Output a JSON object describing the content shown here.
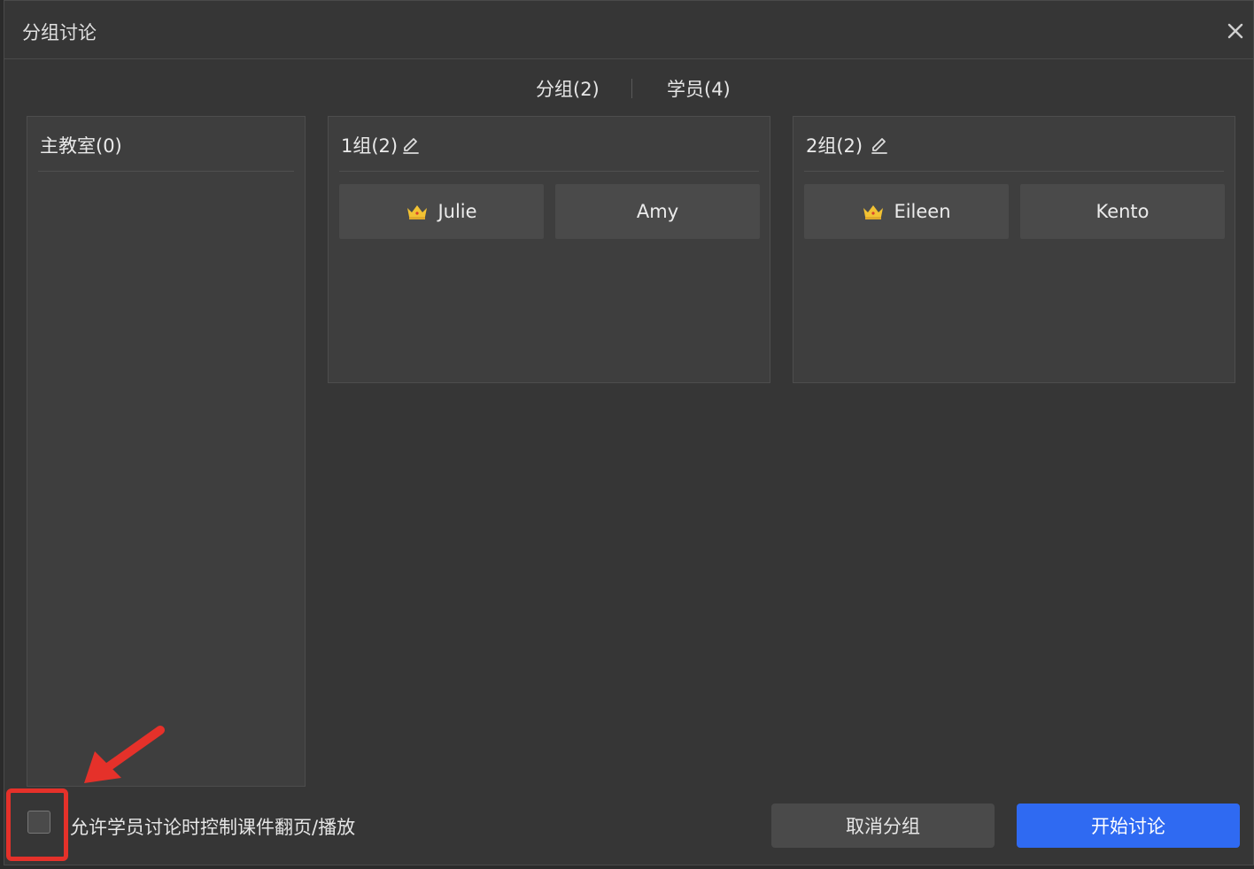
{
  "dialog": {
    "title": "分组讨论"
  },
  "tabs": {
    "groups_label": "分组(2)",
    "students_label": "学员(4)"
  },
  "main_room": {
    "title": "主教室(0)"
  },
  "groups": [
    {
      "title": "1组(2)",
      "members": [
        {
          "name": "Julie",
          "is_leader": true
        },
        {
          "name": "Amy",
          "is_leader": false
        }
      ]
    },
    {
      "title": "2组(2)",
      "members": [
        {
          "name": "Eileen",
          "is_leader": true
        },
        {
          "name": "Kento",
          "is_leader": false
        }
      ]
    }
  ],
  "footer": {
    "allow_control_label": "允许学员讨论时控制课件翻页/播放",
    "allow_control_checked": false,
    "cancel_label": "取消分组",
    "start_label": "开始讨论"
  },
  "colors": {
    "accent": "#2f6af2",
    "highlight": "#e5312a",
    "crown": "#f2c233"
  },
  "icons": {
    "close": "close-icon",
    "edit": "pencil-icon",
    "leader": "crown-icon",
    "annotation": "arrow-icon"
  }
}
